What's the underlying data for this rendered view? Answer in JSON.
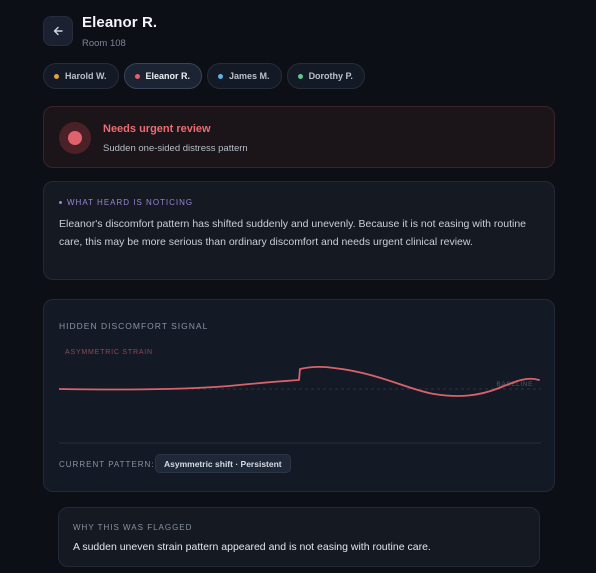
{
  "header": {
    "back_icon": "arrow-left-icon",
    "name": "Eleanor R.",
    "room": "Room 108"
  },
  "patients": [
    {
      "label": "Harold W.",
      "dot_color": "#e2a03f",
      "active": false
    },
    {
      "label": "Eleanor R.",
      "dot_color": "#e0626c",
      "active": true
    },
    {
      "label": "James M.",
      "dot_color": "#5ab4e6",
      "active": false
    },
    {
      "label": "Dorothy P.",
      "dot_color": "#5cc98a",
      "active": false
    }
  ],
  "alert": {
    "title": "Needs urgent review",
    "subtitle": "Sudden one-sided distress pattern",
    "color": "#e0626c"
  },
  "notice": {
    "label": "WHAT HEARD IS NOTICING",
    "text": "Eleanor's discomfort pattern has shifted suddenly and unevenly. Because it is not easing with routine care, this may be more serious than ordinary discomfort and needs urgent clinical review."
  },
  "signal": {
    "title": "HIDDEN DISCOMFORT SIGNAL",
    "series_label": "ASYMMETRIC STRAIN",
    "baseline_label": "BASELINE",
    "line_color": "#d9626a",
    "pattern_label": "CURRENT PATTERN:",
    "pattern_value": "Asymmetric shift · Persistent"
  },
  "why": {
    "label": "WHY THIS WAS FLAGGED",
    "text": "A sudden uneven strain pattern appeared and is not easing with routine care."
  }
}
